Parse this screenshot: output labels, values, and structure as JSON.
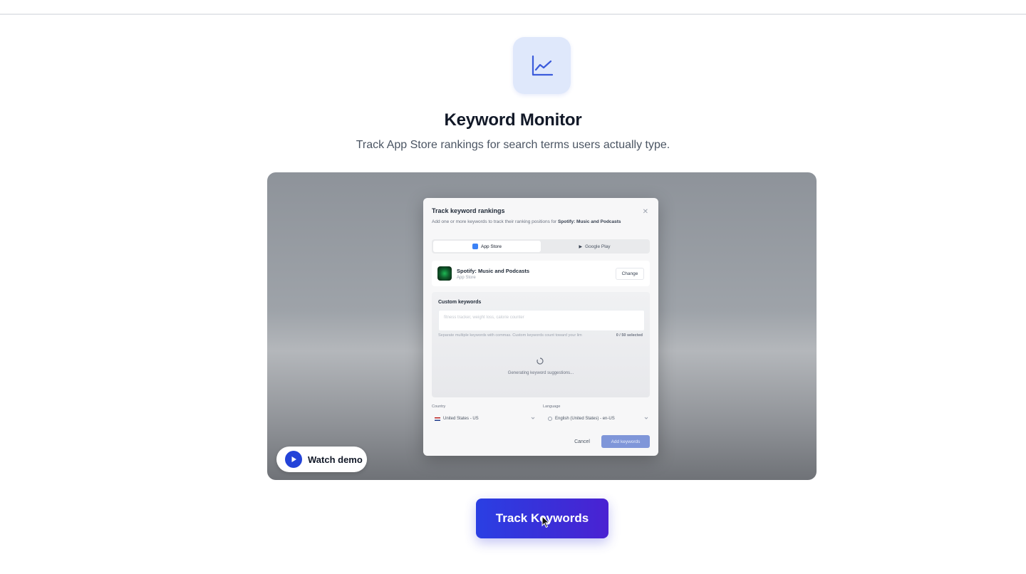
{
  "header": {
    "icon": "line-chart-icon",
    "title": "Keyword Monitor",
    "subtitle": "Track App Store rankings for search terms users actually type."
  },
  "demo": {
    "watch_label": "Watch demo",
    "dialog": {
      "title": "Track keyword rankings",
      "description_prefix": "Add one or more keywords to track their ranking positions for",
      "description_app": "Spotify: Music and Podcasts",
      "tabs": [
        {
          "label": "App Store",
          "active": true,
          "icon": "app-store-icon"
        },
        {
          "label": "Google Play",
          "active": false,
          "icon": "google-play-icon"
        }
      ],
      "app": {
        "name": "Spotify: Music and Podcasts",
        "store": "App Store",
        "change_label": "Change"
      },
      "keywords": {
        "label": "Custom keywords",
        "placeholder": "fitness tracker, weight loss, calorie counter",
        "help": "Separate multiple keywords with commas. Custom keywords count toward your lim",
        "count": "0 / 50 selected",
        "status": "Generating keyword suggestions..."
      },
      "country": {
        "label": "Country",
        "value": "United States - US"
      },
      "language": {
        "label": "Language",
        "value": "English (United States) - en-US"
      },
      "cancel_label": "Cancel",
      "submit_label": "Add keywords"
    }
  },
  "cta": {
    "label": "Track Keywords"
  },
  "colors": {
    "accent": "#2a3fe3",
    "icon_tile": "#dfe8fb",
    "icon_stroke": "#3b5bdb"
  }
}
